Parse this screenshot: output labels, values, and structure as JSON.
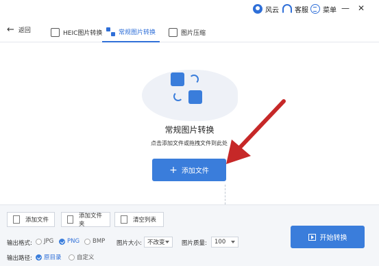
{
  "titlebar": {
    "user_label": "风云",
    "service_label": "客服",
    "menu_label": "菜单",
    "minimize": "—",
    "close": "✕"
  },
  "nav": {
    "back_label": "返回",
    "tabs": [
      {
        "label": "HEIC图片转换",
        "active": false
      },
      {
        "label": "常规图片转换",
        "active": true
      },
      {
        "label": "图片压缩",
        "active": false
      }
    ]
  },
  "drop": {
    "title": "常规图片转换",
    "subtitle": "点击添加文件或拖拽文件到此处",
    "add_button": "添加文件"
  },
  "toolbar": {
    "add_file": "添加文件",
    "add_folder": "添加文件夹",
    "clear_list": "清空列表"
  },
  "options": {
    "format_label": "输出格式:",
    "formats": [
      {
        "label": "JPG",
        "selected": false
      },
      {
        "label": "PNG",
        "selected": true
      },
      {
        "label": "BMP",
        "selected": false
      }
    ],
    "size_label": "图片大小:",
    "size_value": "不改变",
    "quality_label": "图片质量:",
    "quality_value": "100",
    "path_label": "输出路径:",
    "paths": [
      {
        "label": "原目录",
        "selected": true
      },
      {
        "label": "自定义",
        "selected": false
      }
    ],
    "start_button": "开始转换"
  },
  "colors": {
    "accent": "#3a7ddb",
    "arrow": "#c62828"
  }
}
